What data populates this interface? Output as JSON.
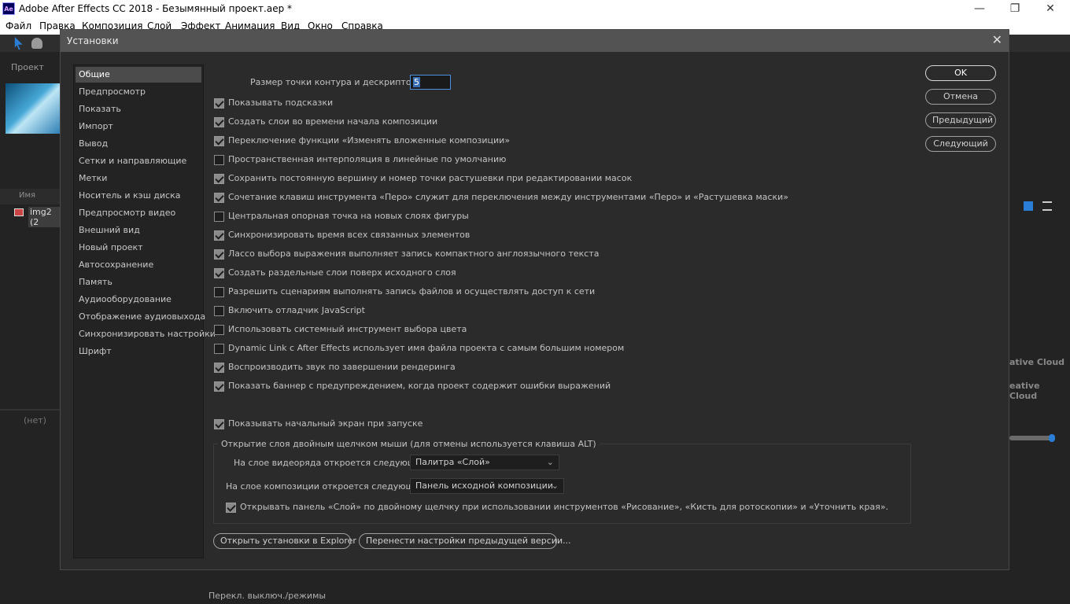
{
  "window": {
    "title": "Adobe After Effects CC 2018 - Безымянный проект.aep *",
    "logo": "Ae",
    "min": "—",
    "max": "❐",
    "close": "✕"
  },
  "menu": [
    "Файл",
    "Правка",
    "Композиция",
    "Слой",
    "Эффект",
    "Анимация",
    "Вид",
    "Окно",
    "Справка"
  ],
  "bg": {
    "project_tab": "Проект",
    "name_col": "Имя",
    "item": "img2 (2",
    "none_tab": "(нет)",
    "footer": "Перекл. выключ./режимы",
    "cc1": "ative Cloud",
    "cc2": "eative Cloud"
  },
  "dialog": {
    "title": "Установки",
    "close": "✕",
    "categories": [
      "Общие",
      "Предпросмотр",
      "Показать",
      "Импорт",
      "Вывод",
      "Сетки и направляющие",
      "Метки",
      "Носитель и кэш диска",
      "Предпросмотр видео",
      "Внешний вид",
      "Новый проект",
      "Автосохранение",
      "Память",
      "Аудиооборудование",
      "Отображение аудиовыхода",
      "Синхронизировать настройки",
      "Шрифт"
    ],
    "selected_category": "Общие",
    "path_point_label": "Размер точки контура и дескриптора:",
    "path_point_value": "5",
    "options": [
      {
        "label": "Показывать подсказки",
        "checked": true
      },
      {
        "label": "Создать слои во времени начала композиции",
        "checked": true
      },
      {
        "label": "Переключение функции «Изменять вложенные композиции»",
        "checked": true
      },
      {
        "label": "Пространственная интерполяция в линейные по умолчанию",
        "checked": false
      },
      {
        "label": "Сохранить постоянную вершину и номер точки растушевки при редактировании масок",
        "checked": true
      },
      {
        "label": "Сочетание клавиш инструмента «Перо» служит для переключения между инструментами «Перо» и «Растушевка маски»",
        "checked": true
      },
      {
        "label": "Центральная опорная точка на новых слоях фигуры",
        "checked": false
      },
      {
        "label": "Синхронизировать время всех связанных элементов",
        "checked": true
      },
      {
        "label": "Лассо выбора выражения выполняет запись компактного англоязычного текста",
        "checked": true
      },
      {
        "label": "Создать раздельные слои поверх исходного слоя",
        "checked": true
      },
      {
        "label": "Разрешить сценариям выполнять запись файлов и осуществлять доступ к сети",
        "checked": false
      },
      {
        "label": "Включить отладчик JavaScript",
        "checked": false
      },
      {
        "label": "Использовать системный инструмент выбора цвета",
        "checked": false
      },
      {
        "label": "Dynamic Link с After Effects использует имя файла проекта с самым большим номером",
        "checked": false
      },
      {
        "label": "Воспроизводить звук по завершении рендеринга",
        "checked": true
      },
      {
        "label": "Показать баннер с предупреждением, когда проект содержит ошибки выражений",
        "checked": true
      }
    ],
    "start_screen": {
      "label": "Показывать начальный экран при запуске",
      "checked": true
    },
    "group_title": "Открытие слоя двойным щелчком мыши (для отмены используется клавиша ALT)",
    "footage_label": "На слое видеоряда откроется следующее:",
    "footage_value": "Палитра «Слой»",
    "comp_label": "На слое композиции откроется следующее:",
    "comp_value": "Панель исходной композиции",
    "paint_option": {
      "label": "Открывать панель «Слой» по двойному щелчку при использовании инструментов «Рисование», «Кисть для ротоскопии» и «Уточнить края».",
      "checked": true
    },
    "btn_explorer": "Открыть установки в Explorer",
    "btn_migrate": "Перенести настройки предыдущей версии...",
    "buttons": {
      "ok": "OK",
      "cancel": "Отмена",
      "prev": "Предыдущий",
      "next": "Следующий"
    }
  }
}
